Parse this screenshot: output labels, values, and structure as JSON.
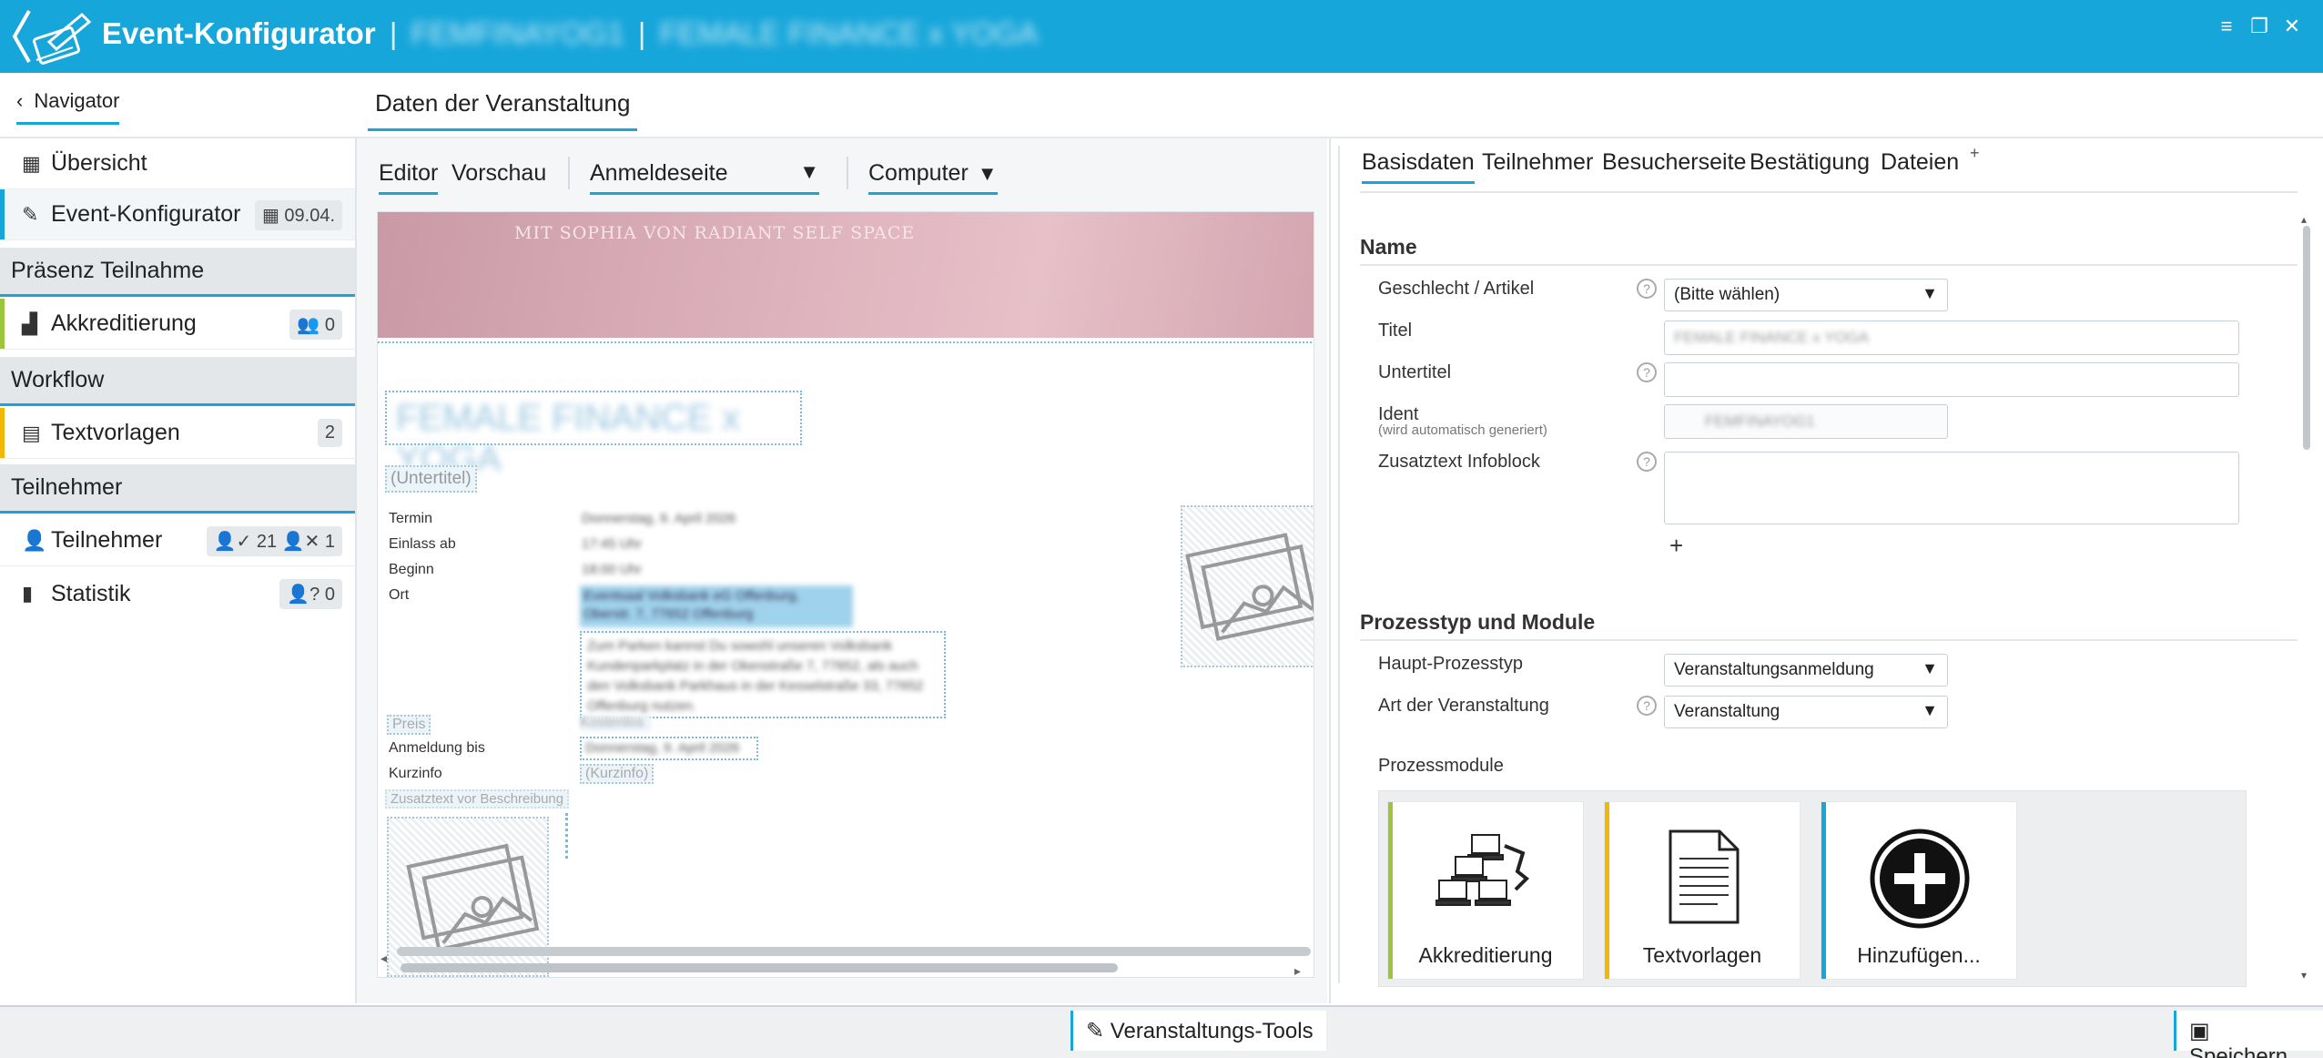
{
  "header": {
    "app_title": "Event-Konfigurator",
    "separator": "|",
    "event_code": "FEMFINAYOG1",
    "event_name": "FEMALE FINANCE x YOGA",
    "controls": [
      "≡",
      "❐",
      "✕"
    ]
  },
  "topbar": {
    "navigator": "Navigator",
    "page_tab": "Daten der Veranstaltung"
  },
  "sidebar": {
    "items": [
      {
        "label": "Übersicht",
        "icon": "grid-icon"
      },
      {
        "label": "Event-Konfigurator",
        "icon": "edit-icon",
        "badge": "09.04."
      }
    ],
    "sections": [
      {
        "title": "Präsenz Teilnahme",
        "items": [
          {
            "label": "Akkreditierung",
            "badge": "0",
            "accent": "#9bc53d"
          }
        ]
      },
      {
        "title": "Workflow",
        "items": [
          {
            "label": "Textvorlagen",
            "badge": "2",
            "accent": "#f2b705"
          }
        ]
      },
      {
        "title": "Teilnehmer",
        "items": [
          {
            "label": "Teilnehmer",
            "badge_a": "21",
            "badge_b": "1"
          },
          {
            "label": "Statistik",
            "badge": "0"
          }
        ]
      }
    ]
  },
  "editor": {
    "mode_tabs": [
      "Editor",
      "Vorschau"
    ],
    "page_select": "Anmeldeseite",
    "device_select": "Computer",
    "preview": {
      "banner_text": "MIT SOPHIA VON RADIANT SELF SPACE",
      "event_title": "FEMALE FINANCE x YOGA",
      "subtitle_placeholder": "(Untertitel)",
      "rows": [
        {
          "label": "Termin",
          "value": "Donnerstag, 9. April 2026"
        },
        {
          "label": "Einlass ab",
          "value": "17:45 Uhr"
        },
        {
          "label": "Beginn",
          "value": "18:00 Uhr"
        },
        {
          "label": "Ort",
          "value": "Eventsaal Volksbank eG Offenburg, Oberstr. 7, 77652 Offenburg"
        }
      ],
      "location_note": "Zum Parken kannst Du sowohl unseren Volksbank Kundenparkplatz in der Okenstraße 7, 77652, als auch den Volksbank Parkhaus in der Kesselstraße 33, 77652 Offenburg nutzen.",
      "price_label": "Preis",
      "price_value": "Kostenlos",
      "reg_until_label": "Anmeldung bis",
      "reg_until_value": "Donnerstag, 9. April 2026",
      "kurzinfo_label": "Kurzinfo",
      "kurzinfo_value": "(Kurzinfo)",
      "zusatz_label": "Zusatztext vor Beschreibung"
    }
  },
  "form": {
    "tabs": [
      "Basisdaten",
      "Teilnehmer",
      "Besucherseite",
      "Bestätigung",
      "Dateien"
    ],
    "tab_plus": "+",
    "name_section": "Name",
    "fields": {
      "gender_label": "Geschlecht / Artikel",
      "gender_value": "(Bitte wählen)",
      "title_label": "Titel",
      "title_value": "FEMALE FINANCE x YOGA",
      "subtitle_label": "Untertitel",
      "ident_label": "Ident",
      "ident_hint": "(wird automatisch generiert)",
      "ident_value": "FEMFINAYOG1",
      "infoblock_label": "Zusatztext Infoblock",
      "add": "+"
    },
    "process_section": "Prozesstyp und Module",
    "process": {
      "main_label": "Haupt-Prozesstyp",
      "main_value": "Veranstaltungsanmeldung",
      "type_label": "Art der Veranstaltung",
      "type_value": "Veranstaltung",
      "modules_label": "Prozessmodule",
      "modules": [
        {
          "label": "Akkreditierung",
          "accent": "#9bc53d",
          "icon": "network-computers-icon"
        },
        {
          "label": "Textvorlagen",
          "accent": "#f2b705",
          "icon": "document-icon"
        },
        {
          "label": "Hinzufügen...",
          "accent": "#17a6da",
          "icon": "add-circle-icon"
        }
      ]
    }
  },
  "footer": {
    "tools": "Veranstaltungs-Tools",
    "save": "Speichern"
  },
  "colors": {
    "brand": "#17a6da",
    "green_accent": "#9bc53d",
    "yellow_accent": "#f2b705"
  }
}
